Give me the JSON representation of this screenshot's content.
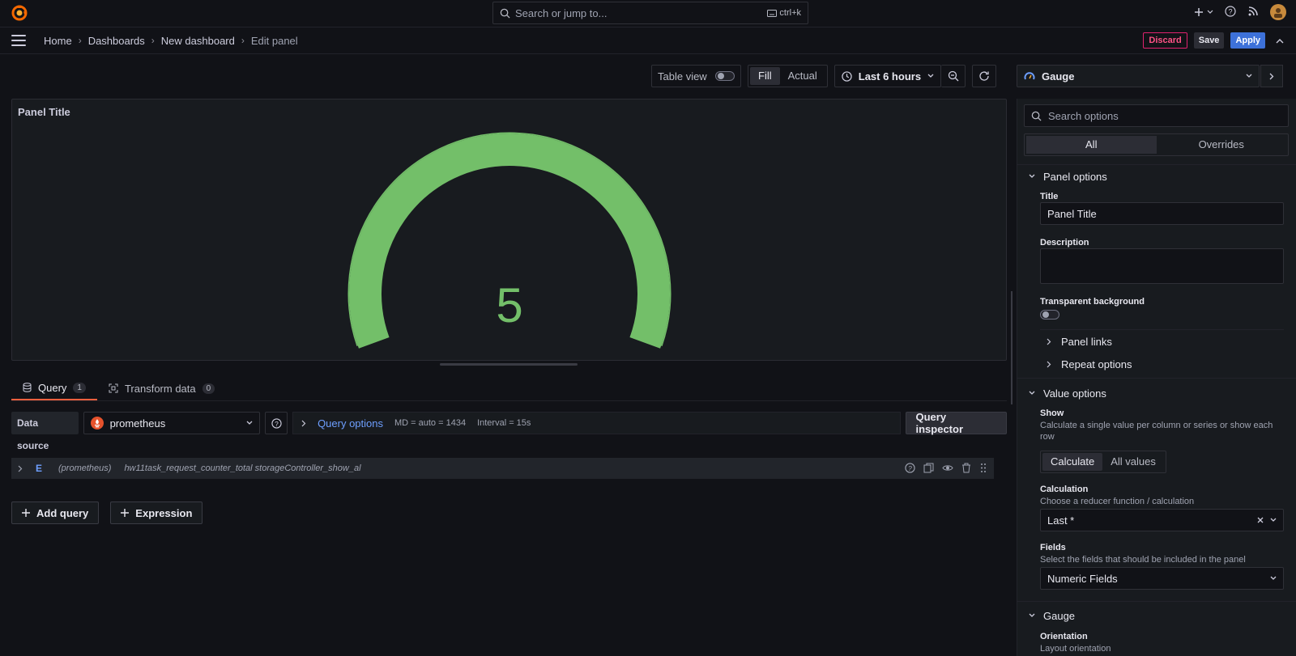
{
  "topbar": {
    "search_placeholder": "Search or jump to...",
    "shortcut": "ctrl+k"
  },
  "breadcrumb": {
    "items": [
      "Home",
      "Dashboards",
      "New dashboard"
    ],
    "current": "Edit panel"
  },
  "actions": {
    "discard": "Discard",
    "save": "Save",
    "apply": "Apply"
  },
  "toolbar": {
    "table_view": "Table view",
    "fill": "Fill",
    "actual": "Actual",
    "time_range": "Last 6 hours"
  },
  "panel": {
    "title": "Panel Title",
    "gauge_value": "5",
    "gauge_fraction": 1.0,
    "gauge_color": "#73bf69"
  },
  "query_tabs": {
    "query": "Query",
    "query_count": "1",
    "transform": "Transform data",
    "transform_count": "0"
  },
  "query": {
    "datasource_label": "Data source",
    "datasource": "prometheus",
    "options_link": "Query options",
    "md": "MD = auto = 1434",
    "interval": "Interval = 15s",
    "inspector": "Query inspector",
    "ref_id": "E",
    "row_ds": "(prometheus)",
    "expr": "hw11task_request_counter_total storageController_show_al"
  },
  "add": {
    "add_query": "Add query",
    "expression": "Expression"
  },
  "options": {
    "viz_name": "Gauge",
    "search_placeholder": "Search options",
    "tab_all": "All",
    "tab_overrides": "Overrides",
    "panel_options": "Panel options",
    "title_label": "Title",
    "title_value": "Panel Title",
    "description_label": "Description",
    "transparent_label": "Transparent background",
    "panel_links": "Panel links",
    "repeat_options": "Repeat options",
    "value_options": "Value options",
    "show_label": "Show",
    "show_desc": "Calculate a single value per column or series or show each row",
    "show_calculate": "Calculate",
    "show_all": "All values",
    "calc_label": "Calculation",
    "calc_desc": "Choose a reducer function / calculation",
    "calc_value": "Last *",
    "fields_label": "Fields",
    "fields_desc": "Select the fields that should be included in the panel",
    "fields_value": "Numeric Fields",
    "gauge_section": "Gauge",
    "orientation_label": "Orientation",
    "orientation_desc": "Layout orientation"
  }
}
